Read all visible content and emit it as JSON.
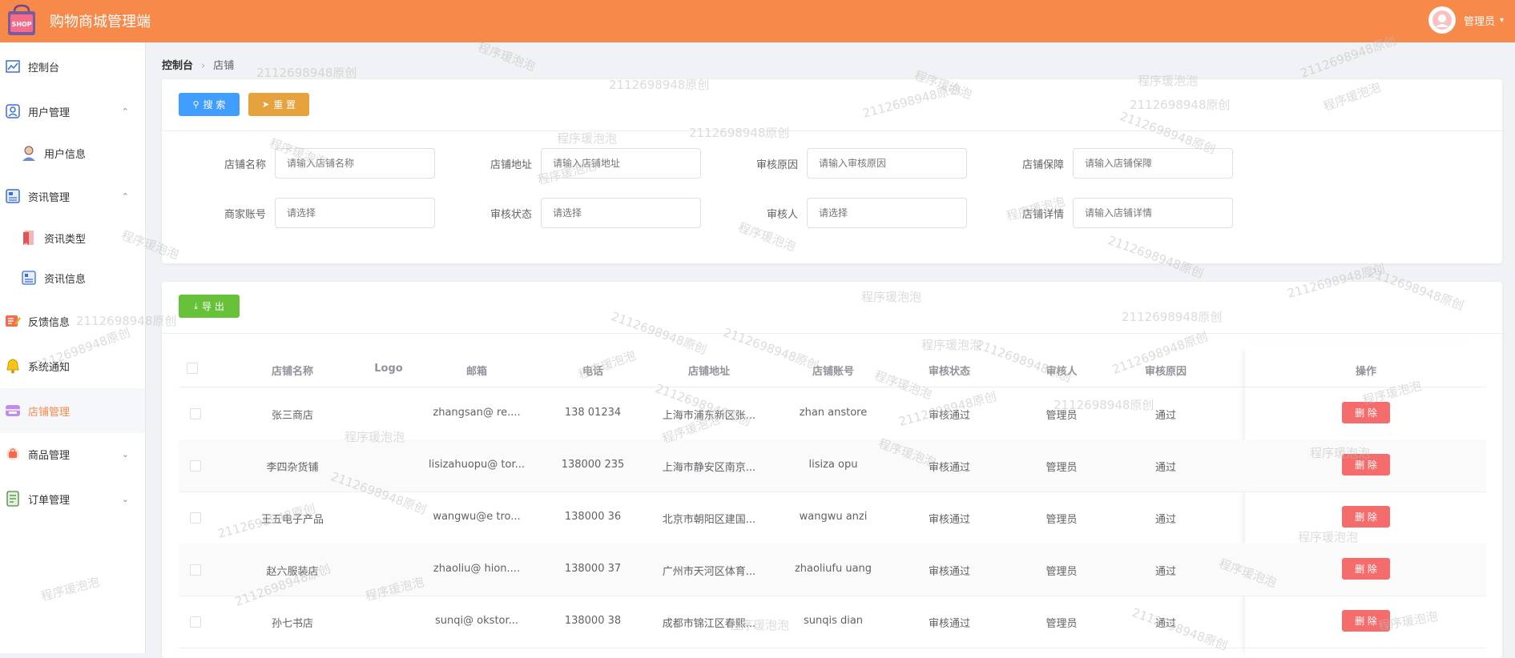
{
  "app": {
    "title": "购物商城管理端",
    "logo_text": "SHOP",
    "user_label": "管理员",
    "accent_color": "#f7894b"
  },
  "sidebar": {
    "items": [
      {
        "label": "控制台",
        "icon": "chart-line-icon"
      },
      {
        "label": "用户管理",
        "icon": "user-icon",
        "expanded": true
      },
      {
        "label": "用户信息",
        "icon": "user-avatar-icon",
        "sub": true
      },
      {
        "label": "资讯管理",
        "icon": "news-icon",
        "expanded": true
      },
      {
        "label": "资讯类型",
        "icon": "bookmark-icon",
        "sub": true
      },
      {
        "label": "资讯信息",
        "icon": "news-doc-icon",
        "sub": true
      },
      {
        "label": "反馈信息",
        "icon": "feedback-icon"
      },
      {
        "label": "系统通知",
        "icon": "bell-icon"
      },
      {
        "label": "店铺管理",
        "icon": "store-icon",
        "active": true
      },
      {
        "label": "商品管理",
        "icon": "bag-icon",
        "expanded": false
      },
      {
        "label": "订单管理",
        "icon": "order-icon",
        "expanded": false
      }
    ]
  },
  "breadcrumb": {
    "root": "控制台",
    "current": "店铺"
  },
  "search": {
    "search_label": "搜 索",
    "reset_label": "重 置",
    "fields": [
      {
        "label": "店铺名称",
        "placeholder": "请输入店铺名称"
      },
      {
        "label": "店铺地址",
        "placeholder": "请输入店铺地址"
      },
      {
        "label": "审核原因",
        "placeholder": "请输入审核原因"
      },
      {
        "label": "店铺保障",
        "placeholder": "请输入店铺保障"
      },
      {
        "label": "商家账号",
        "placeholder": "请选择"
      },
      {
        "label": "审核状态",
        "placeholder": "请选择"
      },
      {
        "label": "审核人",
        "placeholder": "请选择"
      },
      {
        "label": "店铺详情",
        "placeholder": "请输入店铺详情"
      }
    ]
  },
  "table": {
    "export_label": "导 出",
    "headers": {
      "name": "店铺名称",
      "logo": "Logo",
      "email": "邮箱",
      "phone": "电话",
      "address": "店铺地址",
      "account": "店铺账号",
      "status": "审核状态",
      "auditor": "审核人",
      "reason": "审核原因",
      "ops": "操作"
    },
    "delete_label": "删 除",
    "rows": [
      {
        "name": "张三商店",
        "email": "zhangsan@    re....",
        "phone": "138    01234",
        "address": "上海市浦东新区张...",
        "account": "zhan    anstore",
        "status": "审核通过",
        "auditor": "管理员",
        "reason": "通过"
      },
      {
        "name": "李四杂货铺",
        "email": "lisizahuopu@    tor...",
        "phone": "138000    235",
        "address": "上海市静安区南京...",
        "account": "lisiza    opu",
        "status": "审核通过",
        "auditor": "管理员",
        "reason": "通过"
      },
      {
        "name": "王五电子产品",
        "email": "wangwu@e    tro...",
        "phone": "138000    36",
        "address": "北京市朝阳区建国...",
        "account": "wangwu    anzi",
        "status": "审核通过",
        "auditor": "管理员",
        "reason": "通过"
      },
      {
        "name": "赵六服装店",
        "email": "zhaoliu@    hion....",
        "phone": "138000    37",
        "address": "广州市天河区体育...",
        "account": "zhaoliufu    uang",
        "status": "审核通过",
        "auditor": "管理员",
        "reason": "通过"
      },
      {
        "name": "孙七书店",
        "email": "sunqi@    okstor...",
        "phone": "138000    38",
        "address": "成都市锦江区春熙...",
        "account": "sunqis    dian",
        "status": "审核通过",
        "auditor": "管理员",
        "reason": "通过"
      }
    ]
  },
  "watermarks": {
    "a": "程序瑗泡泡",
    "b": "2112698948原创"
  }
}
